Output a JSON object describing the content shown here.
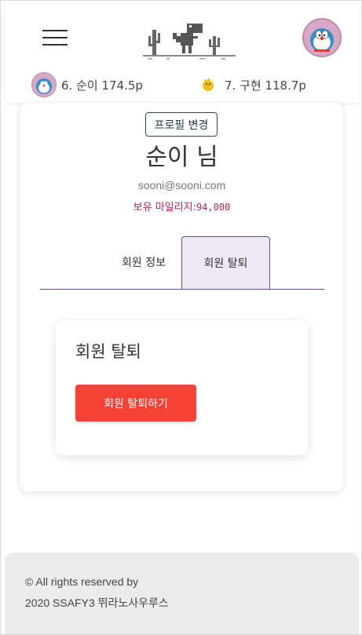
{
  "header": {
    "menu_icon": "hamburger-menu-icon",
    "logo_icon": "dino-cactus-logo",
    "avatar_icon": "doraemon-avatar"
  },
  "ranking": [
    {
      "label": "6. 순이 174.5p",
      "icon": "doraemon-avatar"
    },
    {
      "label": "7. 구현 118.7p",
      "icon": "chick-icon"
    }
  ],
  "profile": {
    "edit_button": "프로필 변경",
    "nickname": "순이 님",
    "email": "sooni@sooni.com",
    "mileage_label": "보유 마일리지:",
    "mileage_value": "94,000"
  },
  "tabs": [
    {
      "label": "회원 정보",
      "active": false
    },
    {
      "label": "회원 탈퇴",
      "active": true
    }
  ],
  "withdraw": {
    "title": "회원 탈퇴",
    "button": "회원 탈퇴하기"
  },
  "footer": {
    "line1": "© All rights reserved by",
    "line2": "2020 SSAFY3 뛰라노사우루스"
  },
  "colors": {
    "accent_purple": "#6b4c88",
    "tab_active_bg": "#efe8f5",
    "danger": "#f44336",
    "mileage": "#b0285c"
  }
}
